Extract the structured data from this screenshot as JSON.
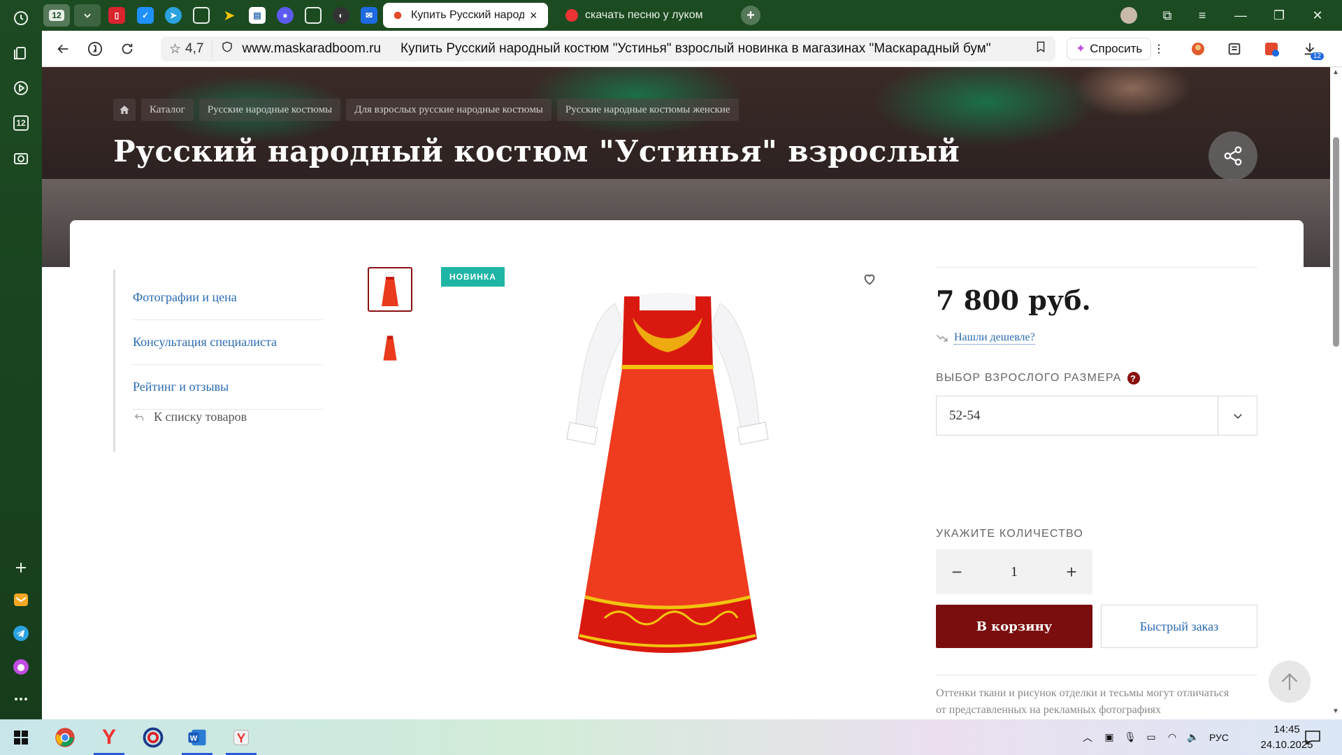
{
  "browser": {
    "tab_counter": "12",
    "tabs": [
      {
        "title": "Купить Русский народный костюм",
        "active": true
      },
      {
        "title": "скачать песню у лукоморья",
        "active": false
      }
    ],
    "address": {
      "rating": "4,7",
      "domain": "www.maskaradboom.ru",
      "page_title": "Купить Русский народный костюм \"Устинья\" взрослый новинка в магазинах \"Маскарадный бум\""
    },
    "ask_label": "Спросить",
    "ext_badge": "12"
  },
  "page": {
    "breadcrumbs": [
      "Каталог",
      "Русские народные костюмы",
      "Для взрослых русские народные костюмы",
      "Русские народные костюмы женские"
    ],
    "title": "Русский народный костюм \"Устинья\" взрослый",
    "left_menu": [
      "Фотографии и цена",
      "Консультация специалиста",
      "Рейтинг и отзывы"
    ],
    "back_to_list": "К списку товаров",
    "badge_new": "НОВИНКА",
    "price": "7 800 руб.",
    "found_cheaper": "Нашли дешевле?",
    "size_label": "ВЫБОР ВЗРОСЛОГО РАЗМЕРА",
    "size_help": "?",
    "size_value": "52-54",
    "qty_label": "УКАЖИТЕ КОЛИЧЕСТВО",
    "qty_value": "1",
    "qty_minus": "−",
    "qty_plus": "+",
    "cart_button": "В корзину",
    "quick_order": "Быстрый заказ",
    "note": "Оттенки ткани и рисунок отделки и тесьмы могут отличаться от представленных на рекламных фотографиях"
  },
  "taskbar": {
    "lang": "РУС",
    "time": "14:45",
    "date": "24.10.2025"
  },
  "colors": {
    "accent": "#7a0d0d",
    "link": "#2a6bb0",
    "badge": "#1fb5a5",
    "sidebar": "#1d4a23"
  }
}
